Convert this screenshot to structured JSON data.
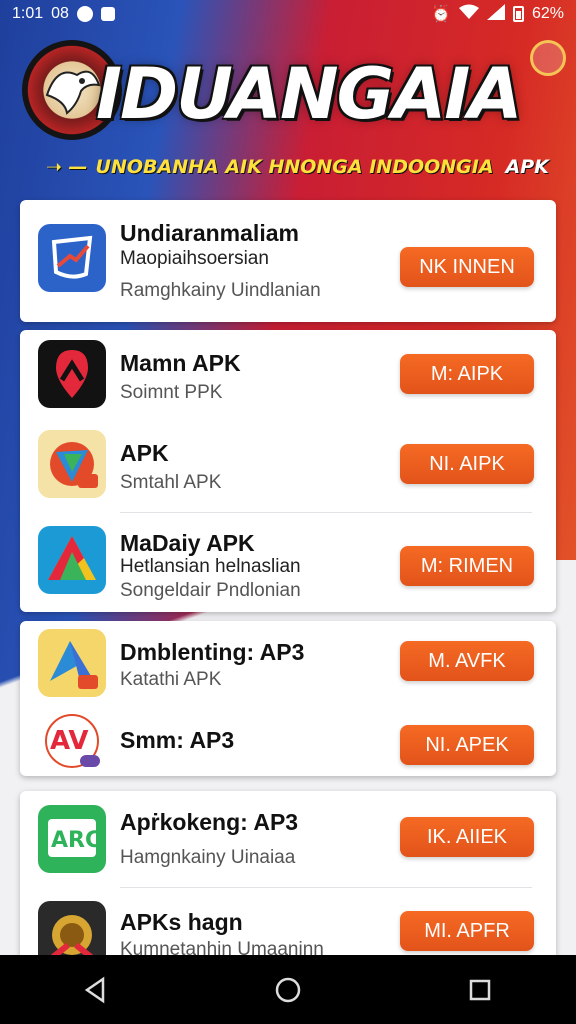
{
  "status_bar": {
    "time": "1:01",
    "left_extra": "08",
    "battery": "62%"
  },
  "header": {
    "title": "IDUANGAIA",
    "tagline": "UNOBANHA AIK HNONGA INDOONGIA",
    "tagline_suffix": "APK"
  },
  "apps": [
    {
      "title": "Undiaranmaliam",
      "subtitle": "Maopiaihsoersian",
      "subtitle2": "Ramghkainy Uindlanian",
      "button": "NK INNEN",
      "icon": "chart-shield-icon"
    },
    {
      "title": "Mamn APK",
      "subtitle": "Soimnt PPK",
      "button": "M: AIPK",
      "icon": "location-pin-icon"
    },
    {
      "title": "APK",
      "subtitle": "Smtahl APK",
      "button": "NI. AIPK",
      "icon": "shield-icon"
    },
    {
      "title": "MaDaiy APK",
      "subtitle": "Hetlansian helnaslian",
      "subtitle2": "Songeldair Pndlonian",
      "button": "M: RIMEN",
      "icon": "triangle-icon"
    },
    {
      "title": "Dmblenting: AP3",
      "subtitle": "Katathi APK",
      "button": "M. AVFK",
      "icon": "a-logo-icon"
    },
    {
      "title": "Smm: AP3",
      "subtitle": "",
      "button": "NI. APEK",
      "icon": "av-logo-icon"
    },
    {
      "title": "Apṙkokeng: AP3",
      "subtitle": "Hamgnkainy Uinaiaa",
      "button": "IK. AIIEK",
      "icon": "arc-logo-icon"
    },
    {
      "title": "APKs hagn",
      "subtitle": "Kumnetanhin Umaaninn",
      "button": "MI. APFR",
      "icon": "medal-icon"
    }
  ],
  "colors": {
    "accent": "#e8561c",
    "title_yellow": "#ffe13b"
  }
}
